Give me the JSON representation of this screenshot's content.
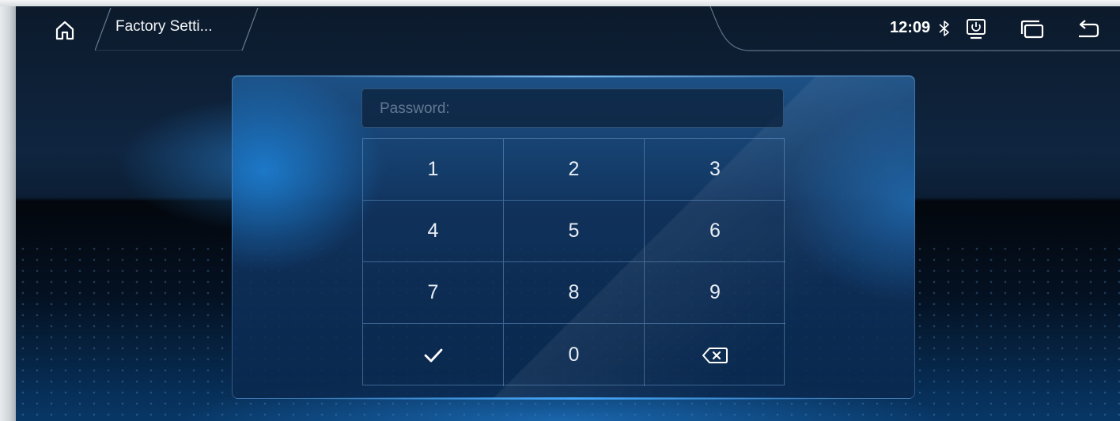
{
  "status_bar": {
    "title": "Factory Setti...",
    "time": "12:09",
    "icons": [
      "home-icon",
      "bluetooth-icon",
      "screen-power-icon",
      "recent-apps-icon",
      "back-icon"
    ]
  },
  "dialog": {
    "password_placeholder": "Password:",
    "keys": [
      "1",
      "2",
      "3",
      "4",
      "5",
      "6",
      "7",
      "8",
      "9",
      "confirm-check-icon",
      "0",
      "backspace-icon"
    ],
    "key_labels": {
      "k1": "1",
      "k2": "2",
      "k3": "3",
      "k4": "4",
      "k5": "5",
      "k6": "6",
      "k7": "7",
      "k8": "8",
      "k9": "9",
      "k0": "0"
    }
  },
  "colors": {
    "accent": "#2f8be0",
    "text": "#e8eef5"
  }
}
